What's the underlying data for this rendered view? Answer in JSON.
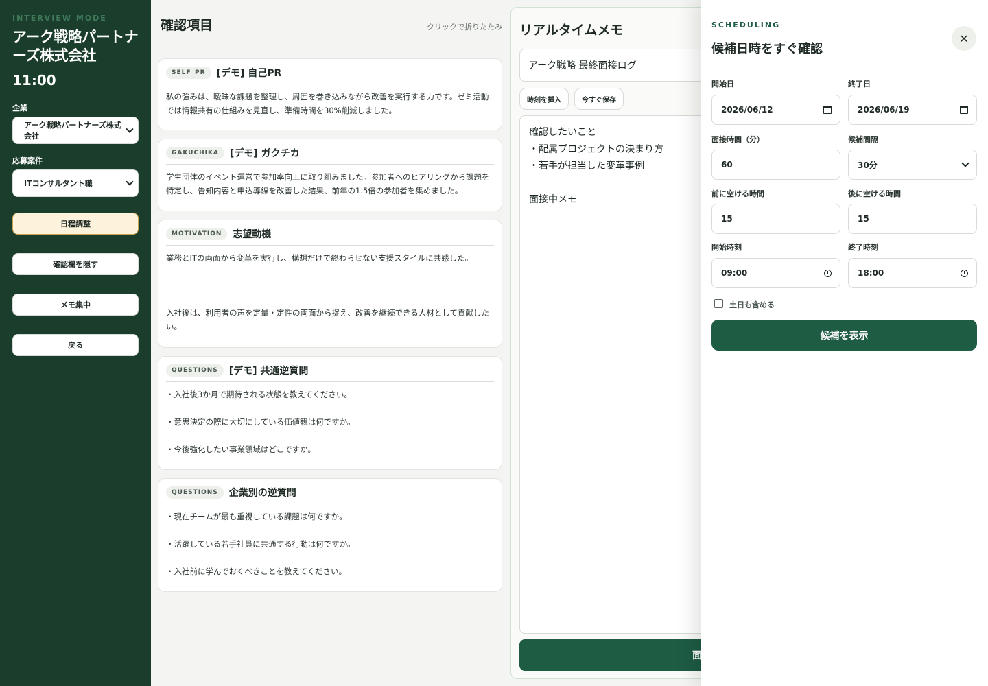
{
  "sidebar": {
    "mode_label": "INTERVIEW MODE",
    "company_title": "アーク戦略パートナーズ株式会社",
    "time": "11:00",
    "company_label": "企業",
    "company_value": "アーク戦略パートナーズ株式会社",
    "position_label": "応募案件",
    "position_value": "ITコンサルタント職",
    "buttons": [
      "日程調整",
      "確認欄を隠す",
      "メモ集中",
      "戻る"
    ]
  },
  "confirm": {
    "title": "確認項目",
    "collapse_hint": "クリックで折りたたみ",
    "cards": [
      {
        "tag": "SELF_PR",
        "title": "[デモ] 自己PR",
        "body": "私の強みは、曖昧な課題を整理し、周囲を巻き込みながら改善を実行する力です。ゼミ活動では情報共有の仕組みを見直し、準備時間を30%削減しました。"
      },
      {
        "tag": "GAKUCHIKA",
        "title": "[デモ] ガクチカ",
        "body": "学生団体のイベント運営で参加率向上に取り組みました。参加者へのヒアリングから課題を特定し、告知内容と申込導線を改善した結果、前年の1.5倍の参加者を集めました。"
      },
      {
        "tag": "MOTIVATION",
        "title": "志望動機",
        "body": "業務とITの両面から変革を実行し、構想だけで終わらせない支援スタイルに共感した。\n\n\n\n入社後は、利用者の声を定量・定性の両面から捉え、改善を継続できる人材として貢献したい。"
      },
      {
        "tag": "QUESTIONS",
        "title": "[デモ] 共通逆質問",
        "body": "・入社後3か月で期待される状態を教えてください。\n\n・意思決定の際に大切にしている価値観は何ですか。\n\n・今後強化したい事業領域はどこですか。"
      },
      {
        "tag": "QUESTIONS",
        "title": "企業別の逆質問",
        "body": "・現在チームが最も重視している課題は何ですか。\n\n・活躍している若手社員に共通する行動は何ですか。\n\n・入社前に学んでおくべきことを教えてください。"
      }
    ]
  },
  "memo": {
    "title": "リアルタイムメモ",
    "log_title": "アーク戦略 最終面接ログ",
    "insert_time_label": "時刻を挿入",
    "save_now_label": "今すぐ保存",
    "content": "確認したいこと\n・配属プロジェクトの決まり方\n・若手が担当した変革事例\n\n面接中メモ",
    "bottom_button_partial": "面"
  },
  "scheduling": {
    "kicker": "SCHEDULING",
    "title": "候補日時をすぐ確認",
    "close_symbol": "✕",
    "start_date_label": "開始日",
    "start_date_value": "2026/06/12",
    "end_date_label": "終了日",
    "end_date_value": "2026/06/19",
    "duration_label": "面接時間（分）",
    "duration_value": "60",
    "interval_label": "候補間隔",
    "interval_value": "30分",
    "buffer_before_label": "前に空ける時間",
    "buffer_before_value": "15",
    "buffer_after_label": "後に空ける時間",
    "buffer_after_value": "15",
    "start_time_label": "開始時刻",
    "start_time_value": "09:00",
    "end_time_label": "終了時刻",
    "end_time_value": "18:00",
    "weekend_label": "土日も含める",
    "weekend_checked": false,
    "show_button": "候補を表示"
  },
  "colors": {
    "sidebar_bg": "#1b3d2c",
    "accent": "#1e5c44",
    "active_button_bg": "#fdf3dc"
  }
}
